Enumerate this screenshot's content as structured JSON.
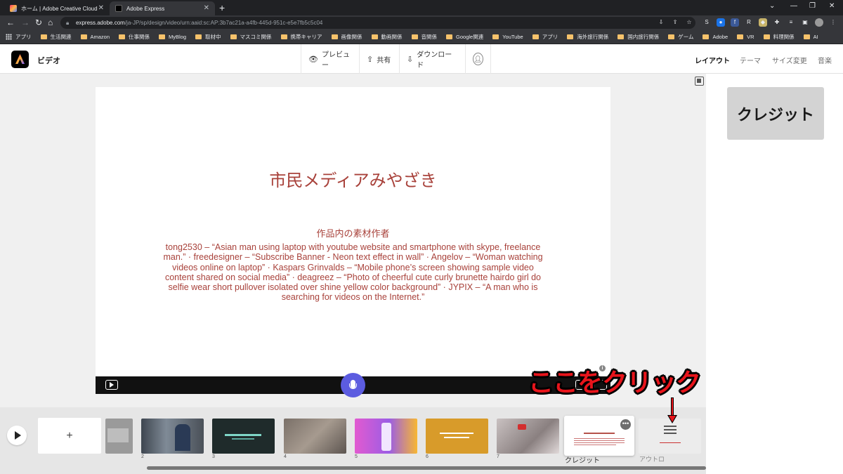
{
  "browser": {
    "tabs": [
      {
        "title": "ホーム | Adobe Creative Cloud"
      },
      {
        "title": "Adobe Express"
      }
    ],
    "url_host": "express.adobe.com",
    "url_path": "/ja-JP/sp/design/video/urn:aaid:sc:AP:3b7ac21a-a4fb-445d-951c-e5e7fb5c5c04",
    "bookmarks": [
      "アプリ",
      "生活関連",
      "Amazon",
      "仕事関係",
      "MyBlog",
      "取材中",
      "マスコミ関係",
      "携帯キャリア",
      "画像関係",
      "動画関係",
      "音関係",
      "Google関連",
      "YouTube",
      "アプリ",
      "海外旅行関係",
      "国内旅行関係",
      "ゲーム",
      "Adobe",
      "VR",
      "料理関係",
      "AI"
    ]
  },
  "header": {
    "app_title": "ビデオ",
    "preview_label": "プレビュー",
    "share_label": "共有",
    "download_label": "ダウンロード",
    "right_nav": [
      "レイアウト",
      "テーマ",
      "サイズ変更",
      "音楽"
    ]
  },
  "right_panel": {
    "layout_label": "クレジット"
  },
  "slide": {
    "title": "市民メディアみやざき",
    "subtitle": "作品内の素材作者",
    "body": "tong2530 – “Asian man using laptop with youtube website and smartphone with skype, freelance man.” · freedesigner – “Subscribe Banner - Neon text effect in wall” · Angelov – “Woman watching videos online on laptop” · Kaspars Grinvalds – “Mobile phone’s screen showing sample video content shared on social media” · deagreez – “Photo of cheerful cute curly brunette hairdo girl do selfie wear short pullover isolated over shine yellow color background” · JYPIX – “A man who is searching for videos on the Internet.”"
  },
  "annotation": {
    "text": "ここをクリック"
  },
  "timeline": {
    "add_label": "+",
    "clips": [
      {
        "num": "",
        "color": "#9a9a9a"
      },
      {
        "num": "2",
        "color": "#5a6470"
      },
      {
        "num": "3",
        "color": "#1f2b2b"
      },
      {
        "num": "4",
        "color": "#7a7068"
      },
      {
        "num": "5",
        "color": "#c94fd6"
      },
      {
        "num": "6",
        "color": "#d89b2a"
      },
      {
        "num": "7",
        "color": "#8a8080"
      }
    ],
    "selected_label": "クレジット",
    "outro_label": "アウトロ"
  },
  "colors": {
    "accent": "#5c5ce0",
    "slide_text": "#a8413a",
    "annotation_red": "#e8141b"
  }
}
